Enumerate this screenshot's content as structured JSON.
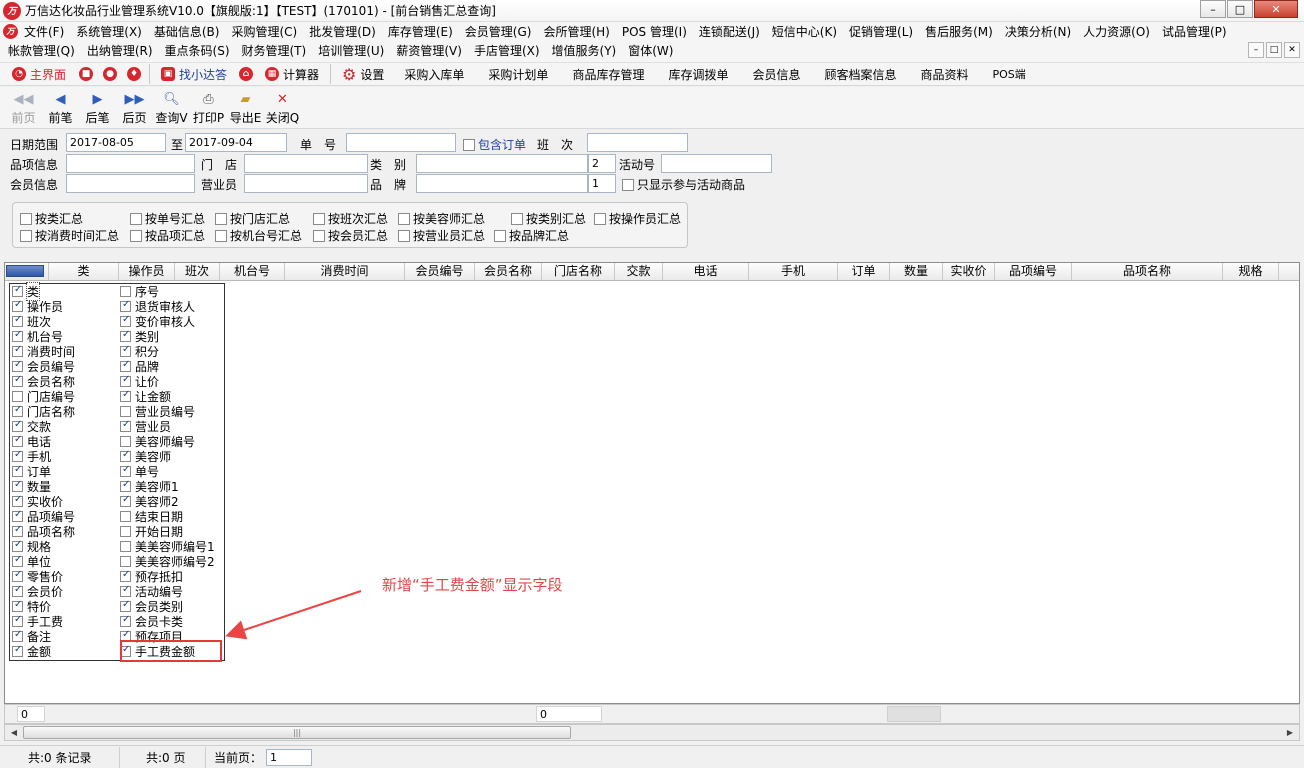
{
  "window": {
    "title": "万信达化妆品行业管理系统V10.0【旗舰版:1】【TEST】(170101) - [前台销售汇总查询]",
    "logo_text": "万",
    "minimize": "–",
    "restore": "□",
    "close": "✕"
  },
  "menu": {
    "row1": [
      "文件(F)",
      "系统管理(X)",
      "基础信息(B)",
      "采购管理(C)",
      "批发管理(D)",
      "库存管理(E)",
      "会员管理(G)",
      "会所管理(H)",
      "POS 管理(I)",
      "连锁配送(J)",
      "短信中心(K)",
      "促销管理(L)",
      "售后服务(M)",
      "决策分析(N)",
      "人力资源(O)",
      "试品管理(P)"
    ],
    "row2": [
      "帐款管理(Q)",
      "出纳管理(R)",
      "重点条码(S)",
      "财务管理(T)",
      "培训管理(U)",
      "薪资管理(V)",
      "手店管理(X)",
      "增值服务(Y)",
      "窗体(W)"
    ]
  },
  "toolbar1": {
    "main": "主界面",
    "find": "找小达答",
    "calculator": "计算器",
    "settings": "设置",
    "links": [
      "采购入库单",
      "采购计划单",
      "商品库存管理",
      "库存调拨单",
      "会员信息",
      "顾客档案信息",
      "商品资料",
      "POS端"
    ]
  },
  "toolbar2": {
    "first": "前页",
    "prev": "前笔",
    "next": "后笔",
    "last": "后页",
    "query": "查询V",
    "print": "打印P",
    "export": "导出E",
    "close": "关闭Q"
  },
  "filter": {
    "date_range_label": "日期范围",
    "date_from": "2017-08-05",
    "to_label": "至",
    "date_to": "2017-09-04",
    "order_no_label": "单　号",
    "include_order_label": "包含订单",
    "shift_label": "班　次",
    "item_info_label": "品项信息",
    "store_label": "门　店",
    "category_label": "类　别",
    "category_code": "2",
    "activity_no_label": "活动号",
    "member_info_label": "会员信息",
    "salesperson_label": "营业员",
    "brand_label": "品　牌",
    "brand_code": "1",
    "only_activity_label": "只显示参与活动商品",
    "group_row1": [
      "按类汇总",
      "按单号汇总",
      "按门店汇总",
      "按班次汇总",
      "按美容师汇总",
      "按类别汇总",
      "按操作员汇总"
    ],
    "group_row2": [
      "按消费时间汇总",
      "按品项汇总",
      "按机台号汇总",
      "按会员汇总",
      "按营业员汇总",
      "按品牌汇总"
    ]
  },
  "grid": {
    "headers": [
      "类",
      "操作员",
      "班次",
      "机台号",
      "消费时间",
      "会员编号",
      "会员名称",
      "门店名称",
      "交款",
      "电话",
      "手机",
      "订单",
      "数量",
      "实收价",
      "品项编号",
      "品项名称",
      "规格"
    ]
  },
  "column_picker": {
    "left": [
      {
        "label": "类",
        "checked": true
      },
      {
        "label": "操作员",
        "checked": true
      },
      {
        "label": "班次",
        "checked": true
      },
      {
        "label": "机台号",
        "checked": true
      },
      {
        "label": "消费时间",
        "checked": true
      },
      {
        "label": "会员编号",
        "checked": true
      },
      {
        "label": "会员名称",
        "checked": true
      },
      {
        "label": "门店编号",
        "checked": false
      },
      {
        "label": "门店名称",
        "checked": true
      },
      {
        "label": "交款",
        "checked": true
      },
      {
        "label": "电话",
        "checked": true
      },
      {
        "label": "手机",
        "checked": true
      },
      {
        "label": "订单",
        "checked": true
      },
      {
        "label": "数量",
        "checked": true
      },
      {
        "label": "实收价",
        "checked": true
      },
      {
        "label": "品项编号",
        "checked": true
      },
      {
        "label": "品项名称",
        "checked": true
      },
      {
        "label": "规格",
        "checked": true
      },
      {
        "label": "单位",
        "checked": true
      },
      {
        "label": "零售价",
        "checked": true
      },
      {
        "label": "会员价",
        "checked": true
      },
      {
        "label": "特价",
        "checked": true
      },
      {
        "label": "手工费",
        "checked": true
      },
      {
        "label": "备注",
        "checked": true
      },
      {
        "label": "金额",
        "checked": true
      }
    ],
    "right": [
      {
        "label": "序号",
        "checked": false
      },
      {
        "label": "退货审核人",
        "checked": true
      },
      {
        "label": "变价审核人",
        "checked": true
      },
      {
        "label": "类别",
        "checked": true
      },
      {
        "label": "积分",
        "checked": true
      },
      {
        "label": "品牌",
        "checked": true
      },
      {
        "label": "让价",
        "checked": true
      },
      {
        "label": "让金额",
        "checked": true
      },
      {
        "label": "营业员编号",
        "checked": false
      },
      {
        "label": "营业员",
        "checked": true
      },
      {
        "label": "美容师编号",
        "checked": false
      },
      {
        "label": "美容师",
        "checked": true
      },
      {
        "label": "单号",
        "checked": true
      },
      {
        "label": "美容师1",
        "checked": true
      },
      {
        "label": "美容师2",
        "checked": true
      },
      {
        "label": "结束日期",
        "checked": false
      },
      {
        "label": "开始日期",
        "checked": false
      },
      {
        "label": "美美容师编号1",
        "checked": false
      },
      {
        "label": "美美容师编号2",
        "checked": false
      },
      {
        "label": "预存抵扣",
        "checked": true
      },
      {
        "label": "活动编号",
        "checked": true
      },
      {
        "label": "会员类别",
        "checked": true
      },
      {
        "label": "会员卡类",
        "checked": true
      },
      {
        "label": "预存项目",
        "checked": true
      },
      {
        "label": "手工费金额",
        "checked": true
      }
    ]
  },
  "annotation": {
    "text": "新增“手工费金额”显示字段",
    "color": "#e04848"
  },
  "footer": {
    "count_left": "0",
    "count_mid": "0",
    "scroll_grip": "|||"
  },
  "status": {
    "records": "共:0 条记录",
    "pages": "共:0 页",
    "current_page_label": "当前页：",
    "current_page": "1"
  }
}
